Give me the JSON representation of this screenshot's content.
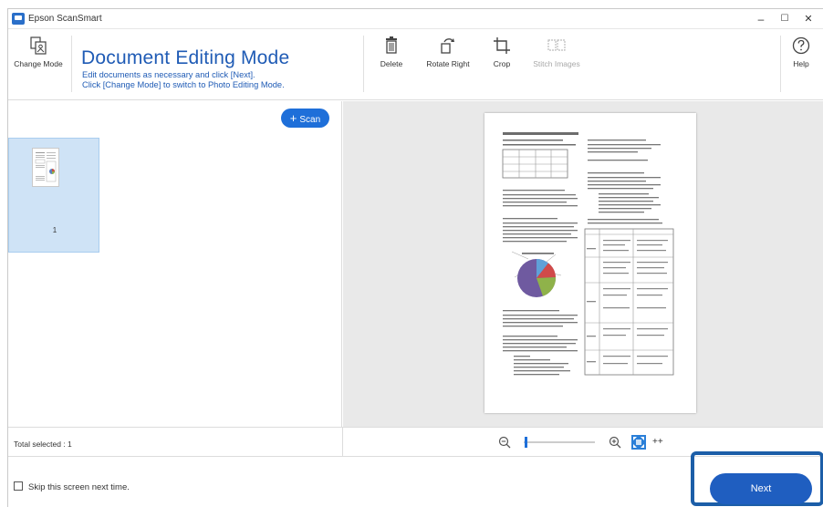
{
  "window": {
    "title": "Epson ScanSmart",
    "minimize": "–",
    "maximize": "☐",
    "close": "✕"
  },
  "toolbar": {
    "change_mode_label": "Change Mode",
    "mode_title": "Document Editing Mode",
    "mode_desc_line1": "Edit documents as necessary and click [Next].",
    "mode_desc_line2": "Click [Change Mode] to switch to Photo Editing Mode.",
    "delete_label": "Delete",
    "rotate_right_label": "Rotate Right",
    "crop_label": "Crop",
    "stitch_images_label": "Stitch Images",
    "help_label": "Help"
  },
  "left_panel": {
    "scan_button_label": "Scan",
    "thumbnails": [
      {
        "number": "1",
        "selected": true
      }
    ]
  },
  "status": {
    "total_selected": "Total selected : 1"
  },
  "zoom": {
    "zoom_out_icon": "zoom-out-icon",
    "zoom_in_icon": "zoom-in-icon",
    "fit_icon": "fit-to-window-icon",
    "actual_size_label": "++"
  },
  "footer": {
    "skip_label": "Skip this screen next time.",
    "skip_checked": false,
    "next_label": "Next"
  },
  "colors": {
    "accent": "#1e6fd9",
    "title_blue": "#1f5bb5",
    "selection": "#cfe3f6",
    "preview_bg": "#e9e9e9",
    "next_frame": "#1c5ea8"
  }
}
